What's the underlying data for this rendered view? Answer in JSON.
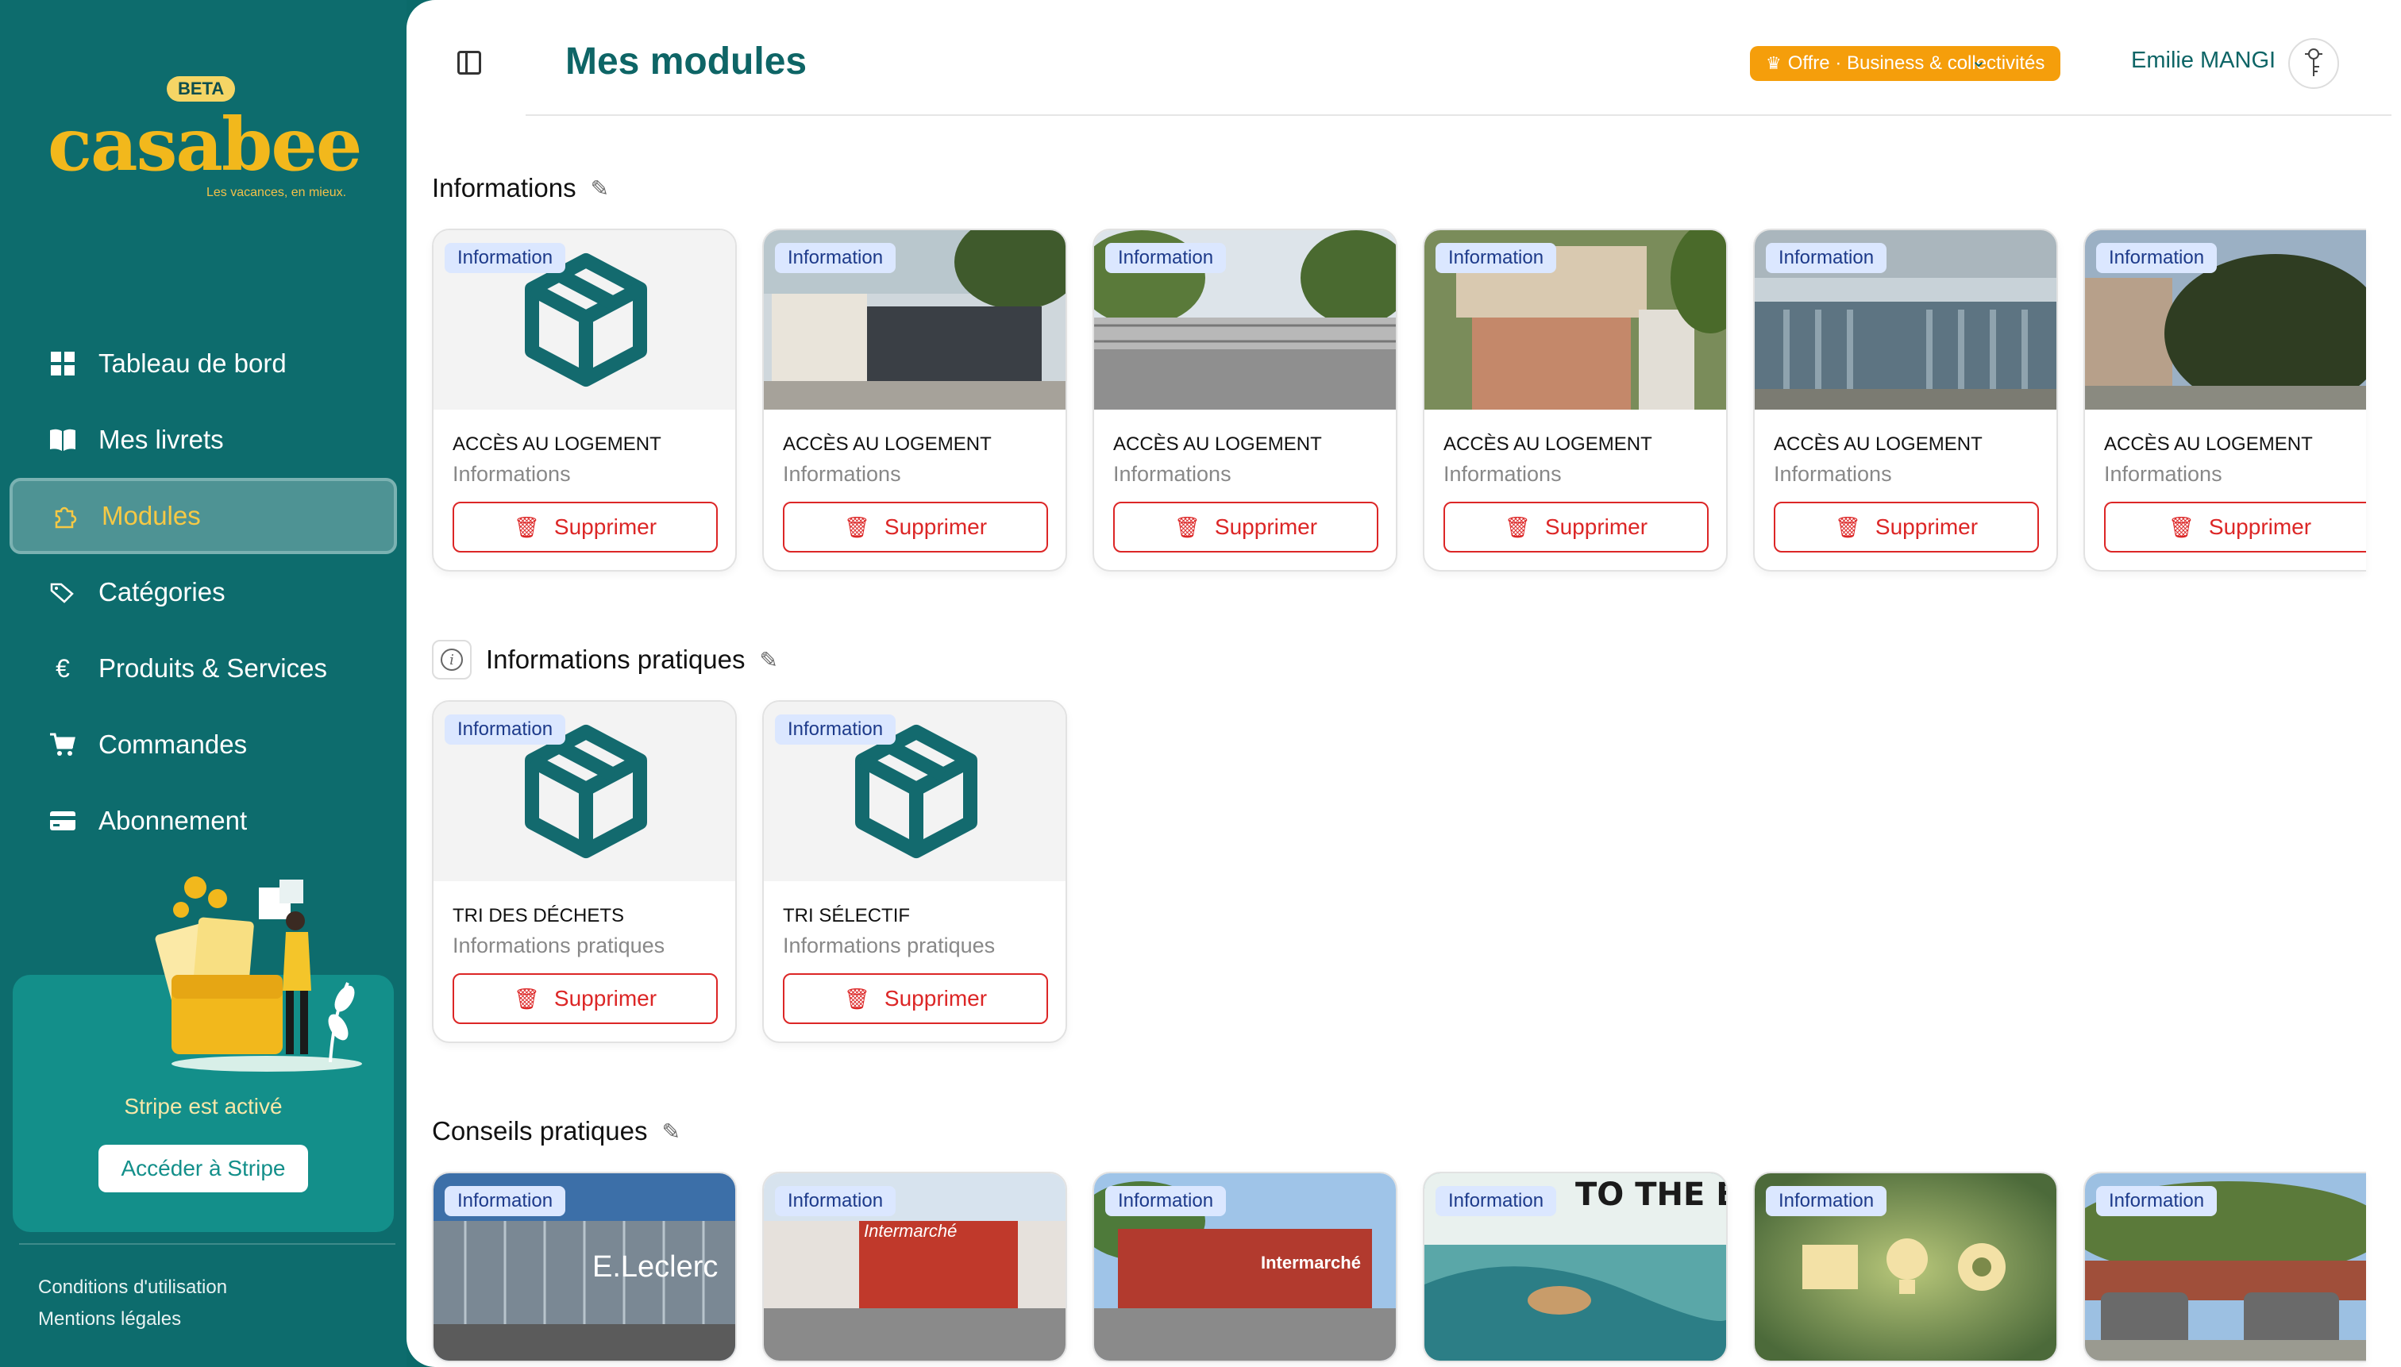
{
  "sidebar": {
    "beta": "BETA",
    "logo": "casabee",
    "tagline": "Les vacances, en mieux.",
    "items": [
      {
        "label": "Tableau de bord",
        "icon": "dashboard-icon"
      },
      {
        "label": "Mes livrets",
        "icon": "book-icon"
      },
      {
        "label": "Modules",
        "icon": "puzzle-icon"
      },
      {
        "label": "Catégories",
        "icon": "tags-icon"
      },
      {
        "label": "Produits & Services",
        "icon": "euro-icon"
      },
      {
        "label": "Commandes",
        "icon": "cart-icon"
      },
      {
        "label": "Abonnement",
        "icon": "credit-card-icon"
      }
    ],
    "active_index": 2,
    "stripe_text": "Stripe est activé",
    "stripe_button": "Accéder à Stripe",
    "footer": {
      "terms": "Conditions d'utilisation",
      "legal": "Mentions légales"
    }
  },
  "header": {
    "title": "Mes modules",
    "offer": "Offre · Business & collectivités",
    "user": "Emilie MANGI"
  },
  "sections": [
    {
      "title": "Informations",
      "cards": [
        {
          "badge": "Information",
          "name": "ACCÈS AU LOGEMENT",
          "category": "Informations",
          "delete": "Supprimer",
          "image": "package-icon"
        },
        {
          "badge": "Information",
          "name": "ACCÈS AU LOGEMENT",
          "category": "Informations",
          "delete": "Supprimer",
          "image": "gate-photo"
        },
        {
          "badge": "Information",
          "name": "ACCÈS AU LOGEMENT",
          "category": "Informations",
          "delete": "Supprimer",
          "image": "gate-photo"
        },
        {
          "badge": "Information",
          "name": "ACCÈS AU LOGEMENT",
          "category": "Informations",
          "delete": "Supprimer",
          "image": "gate-photo"
        },
        {
          "badge": "Information",
          "name": "ACCÈS AU LOGEMENT",
          "category": "Informations",
          "delete": "Supprimer",
          "image": "gate-photo"
        },
        {
          "badge": "Information",
          "name": "ACCÈS AU LOGEMENT",
          "category": "Informations",
          "delete": "Supprimer",
          "image": "gate-photo"
        }
      ]
    },
    {
      "title": "Informations pratiques",
      "cards": [
        {
          "badge": "Information",
          "name": "TRI DES DÉCHETS",
          "category": "Informations pratiques",
          "delete": "Supprimer",
          "image": "package-icon"
        },
        {
          "badge": "Information",
          "name": "TRI SÉLECTIF",
          "category": "Informations pratiques",
          "delete": "Supprimer",
          "image": "package-icon"
        }
      ]
    },
    {
      "title": "Conseils pratiques",
      "cards": [
        {
          "badge": "Information",
          "image": "store-photo",
          "sign": "E.Leclerc"
        },
        {
          "badge": "Information",
          "image": "store-photo",
          "sign": "Intermarché"
        },
        {
          "badge": "Information",
          "image": "store-photo",
          "sign": "Intermarché"
        },
        {
          "badge": "Information",
          "image": "surf-photo",
          "sign": "TO THE BEACH"
        },
        {
          "badge": "Information",
          "image": "ideas-photo"
        },
        {
          "badge": "Information",
          "image": "bins-photo"
        }
      ]
    }
  ],
  "colors": {
    "brand": "#0d6c6d",
    "accent": "#f2b81c",
    "danger": "#dc2626",
    "offer": "#f59e0b"
  }
}
